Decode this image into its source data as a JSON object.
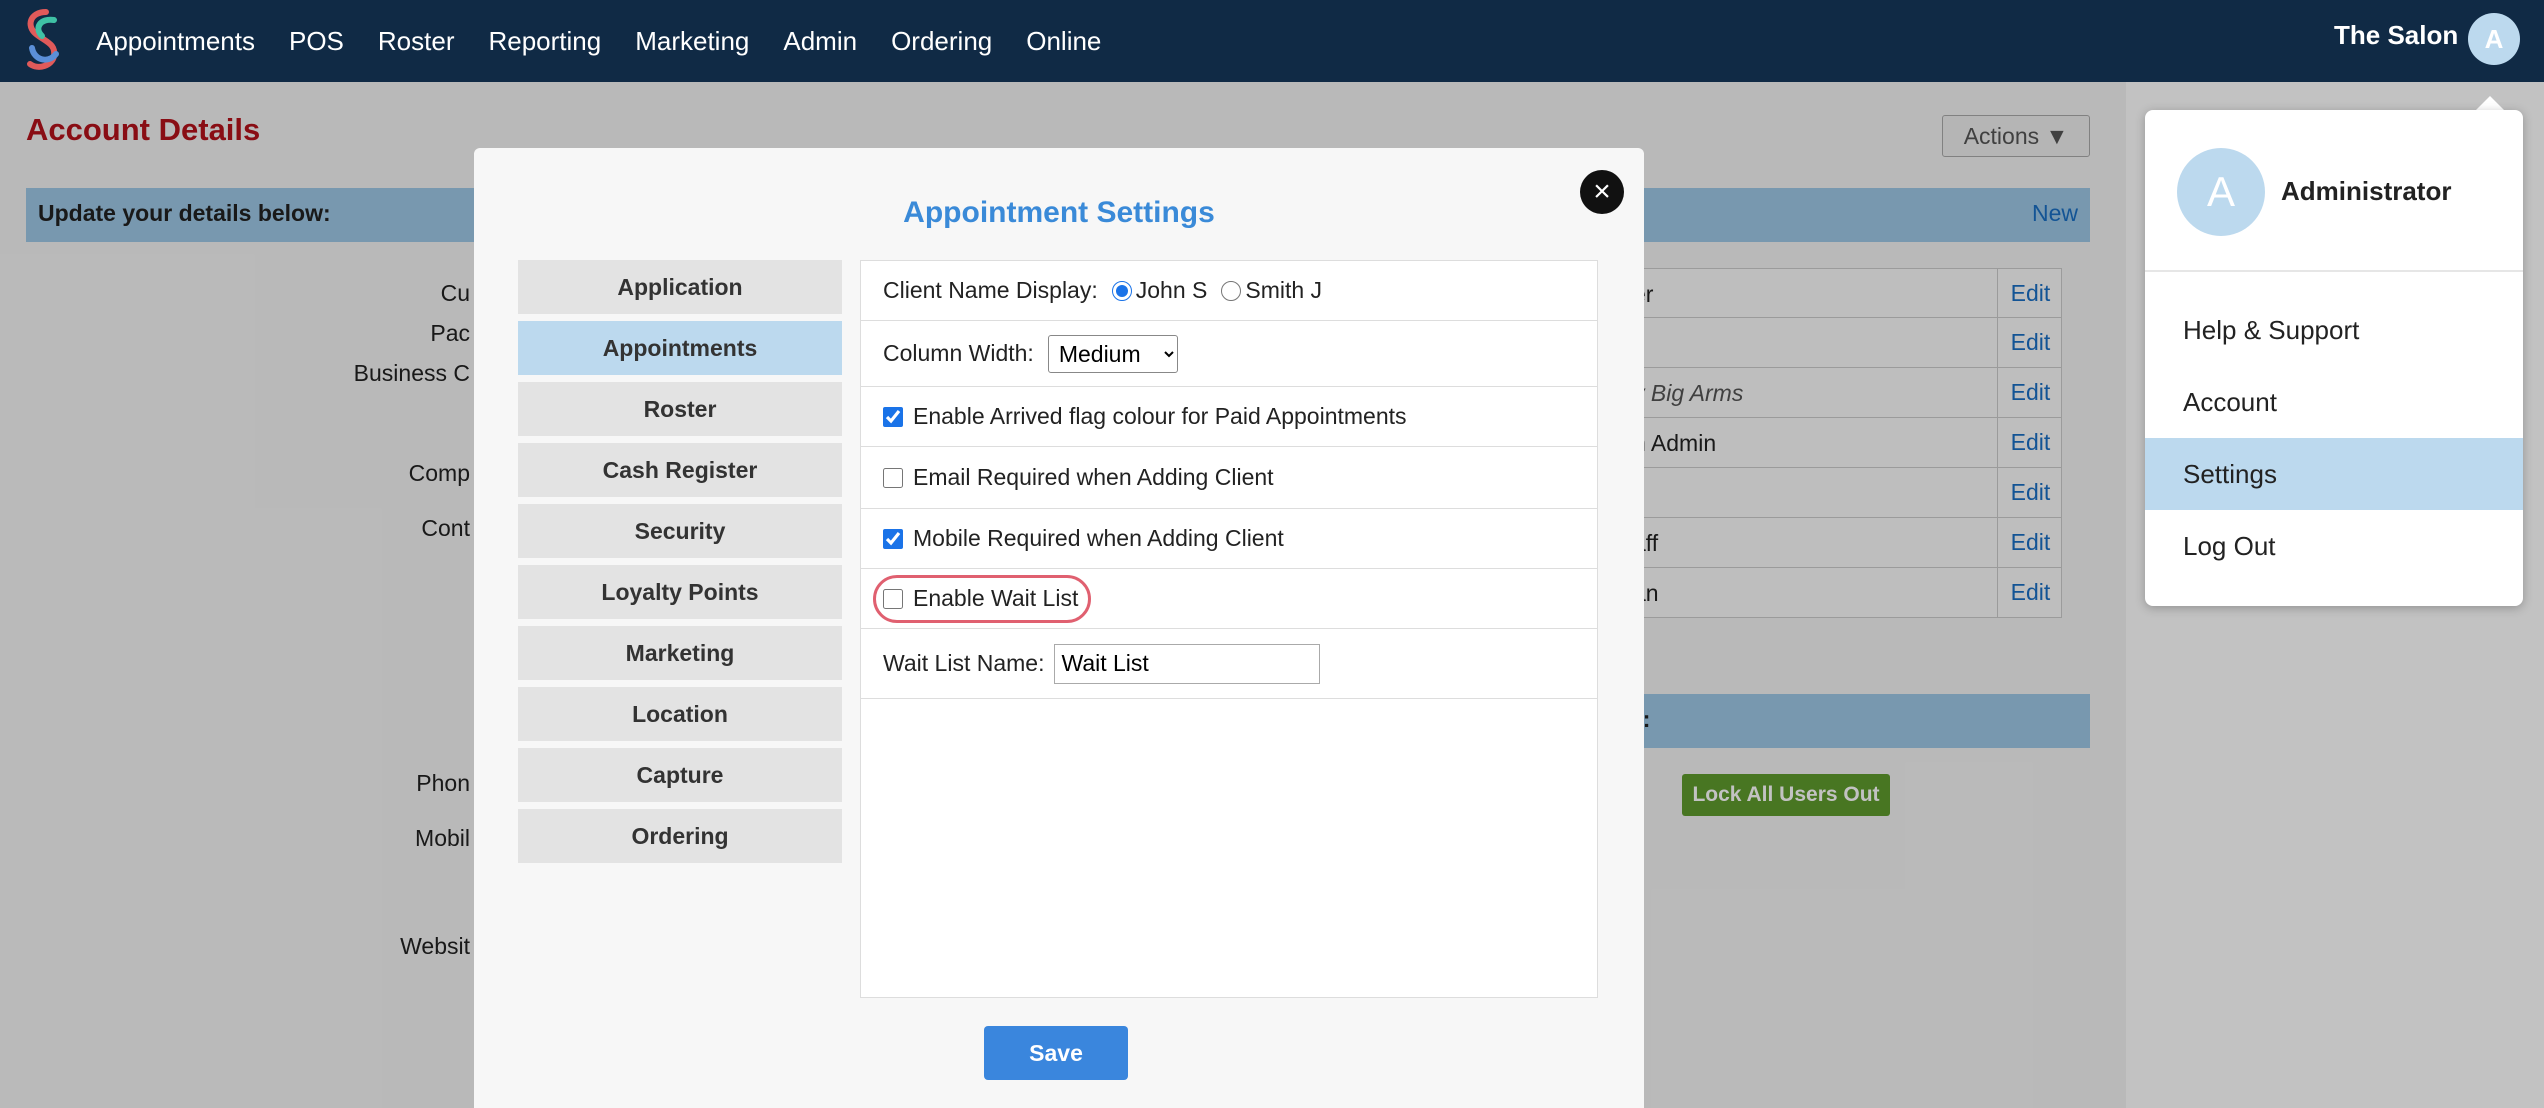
{
  "nav": {
    "items": [
      "Appointments",
      "POS",
      "Roster",
      "Reporting",
      "Marketing",
      "Admin",
      "Ordering",
      "Online"
    ],
    "salon_name": "The Salon",
    "avatar_initial": "A"
  },
  "background": {
    "page_title": "Account Details",
    "actions_label": "Actions ▼",
    "update_label": "Update your details below:",
    "new_label": "New",
    "field_labels": [
      "Cu",
      "Pac",
      "Business C",
      "Comp",
      "Cont",
      "Phon",
      "Mobil",
      "Websit"
    ],
    "table_rows": [
      {
        "value": "er",
        "italic": false
      },
      {
        "value": "",
        "italic": false
      },
      {
        "value": "y Big Arms",
        "italic": true
      },
      {
        "value": "n Admin",
        "italic": false
      },
      {
        "value": "",
        "italic": false
      },
      {
        "value": "aff",
        "italic": false
      },
      {
        "value": "an",
        "italic": false
      }
    ],
    "edit_label": "Edit",
    "section_label": "s:",
    "lock_button": "Lock All Users Out"
  },
  "modal": {
    "title": "Appointment Settings",
    "close_symbol": "×",
    "menu": [
      {
        "label": "Application",
        "active": false
      },
      {
        "label": "Appointments",
        "active": true
      },
      {
        "label": "Roster",
        "active": false
      },
      {
        "label": "Cash Register",
        "active": false
      },
      {
        "label": "Security",
        "active": false
      },
      {
        "label": "Loyalty Points",
        "active": false
      },
      {
        "label": "Marketing",
        "active": false
      },
      {
        "label": "Location",
        "active": false
      },
      {
        "label": "Capture",
        "active": false
      },
      {
        "label": "Ordering",
        "active": false
      }
    ],
    "client_name_display": {
      "label": "Client Name Display:",
      "options": [
        "John S",
        "Smith J"
      ],
      "selected": "John S"
    },
    "column_width": {
      "label": "Column Width:",
      "selected": "Medium"
    },
    "checkboxes": [
      {
        "label": "Enable Arrived flag colour for Paid Appointments",
        "checked": true
      },
      {
        "label": "Email Required when Adding Client",
        "checked": false
      },
      {
        "label": "Mobile Required when Adding Client",
        "checked": true
      },
      {
        "label": "Enable Wait List",
        "checked": false
      }
    ],
    "wait_list_name": {
      "label": "Wait List Name:",
      "value": "Wait List"
    },
    "save_label": "Save"
  },
  "dropdown": {
    "avatar_initial": "A",
    "user_name": "Administrator",
    "items": [
      {
        "label": "Help & Support",
        "active": false
      },
      {
        "label": "Account",
        "active": false
      },
      {
        "label": "Settings",
        "active": true
      },
      {
        "label": "Log Out",
        "active": false
      }
    ]
  },
  "colors": {
    "nav_bg": "#102a45",
    "accent_blue": "#3a86dd",
    "active_bg": "#bcd9ee",
    "title_red": "#b5121b",
    "highlight": "#e06070",
    "lock_green": "#5f9b2d"
  }
}
